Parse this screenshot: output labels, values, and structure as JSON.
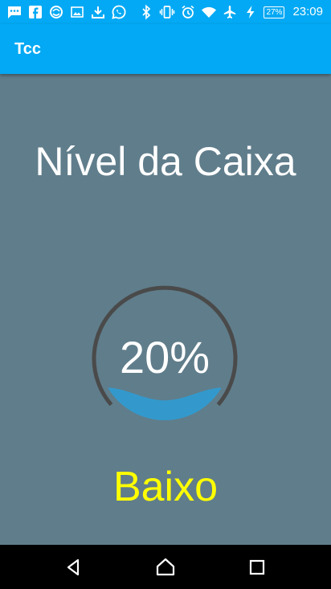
{
  "status_bar": {
    "time": "23:09",
    "battery": "27%",
    "icons": [
      "message-icon",
      "facebook-icon",
      "sticker-icon",
      "image-icon",
      "download-icon",
      "whatsapp-icon",
      "bluetooth-icon",
      "vibrate-icon",
      "alarm-icon",
      "wifi-icon",
      "airplane-icon",
      "charging-icon",
      "battery-icon"
    ]
  },
  "app_bar": {
    "title": "Tcc"
  },
  "main": {
    "headline": "Nível da Caixa",
    "gauge": {
      "percent_label": "20%",
      "level": 0.2
    },
    "status": "Baixo"
  },
  "colors": {
    "app_bar": "#03a9f4",
    "background": "#607d8b",
    "gauge_ring": "#4a4a4a",
    "water": "#3399cc",
    "status_text": "#ffff00"
  },
  "nav_bar": {
    "icons": [
      "back-icon",
      "home-icon",
      "recents-icon"
    ]
  }
}
